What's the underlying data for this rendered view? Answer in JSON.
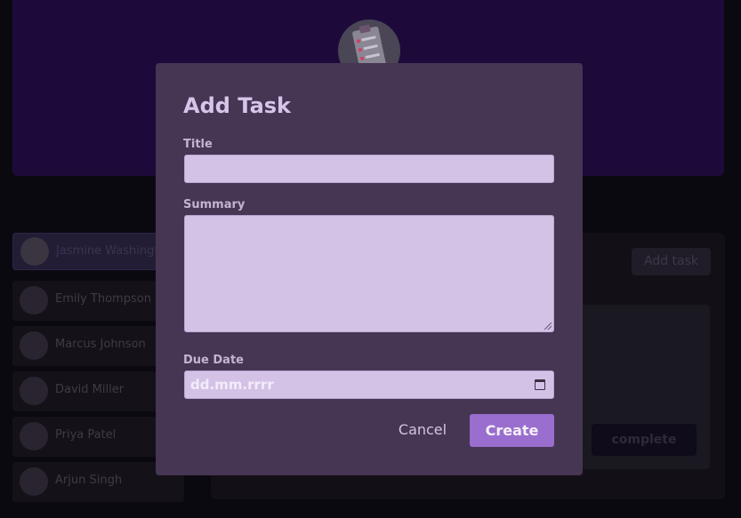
{
  "sidebar": {
    "users": [
      {
        "name": "Jasmine Washington",
        "active": true
      },
      {
        "name": "Emily Thompson",
        "active": false
      },
      {
        "name": "Marcus Johnson",
        "active": false
      },
      {
        "name": "David Miller",
        "active": false
      },
      {
        "name": "Priya Patel",
        "active": false
      },
      {
        "name": "Arjun Singh",
        "active": false
      }
    ]
  },
  "main": {
    "add_task_label": "Add task",
    "complete_label": "complete"
  },
  "modal": {
    "title": "Add Task",
    "title_label": "Title",
    "title_value": "",
    "summary_label": "Summary",
    "summary_value": "",
    "due_date_label": "Due Date",
    "due_date_placeholder": "dd.mm.rrrr",
    "cancel_label": "Cancel",
    "create_label": "Create"
  },
  "colors": {
    "modal_bg": "#463553",
    "input_bg": "#d4c2e6",
    "create_button": "#9a6ece",
    "header_bg": "#1d0a3a"
  },
  "icons": {
    "logo": "clipboard-checklist-icon",
    "date": "calendar-icon"
  }
}
